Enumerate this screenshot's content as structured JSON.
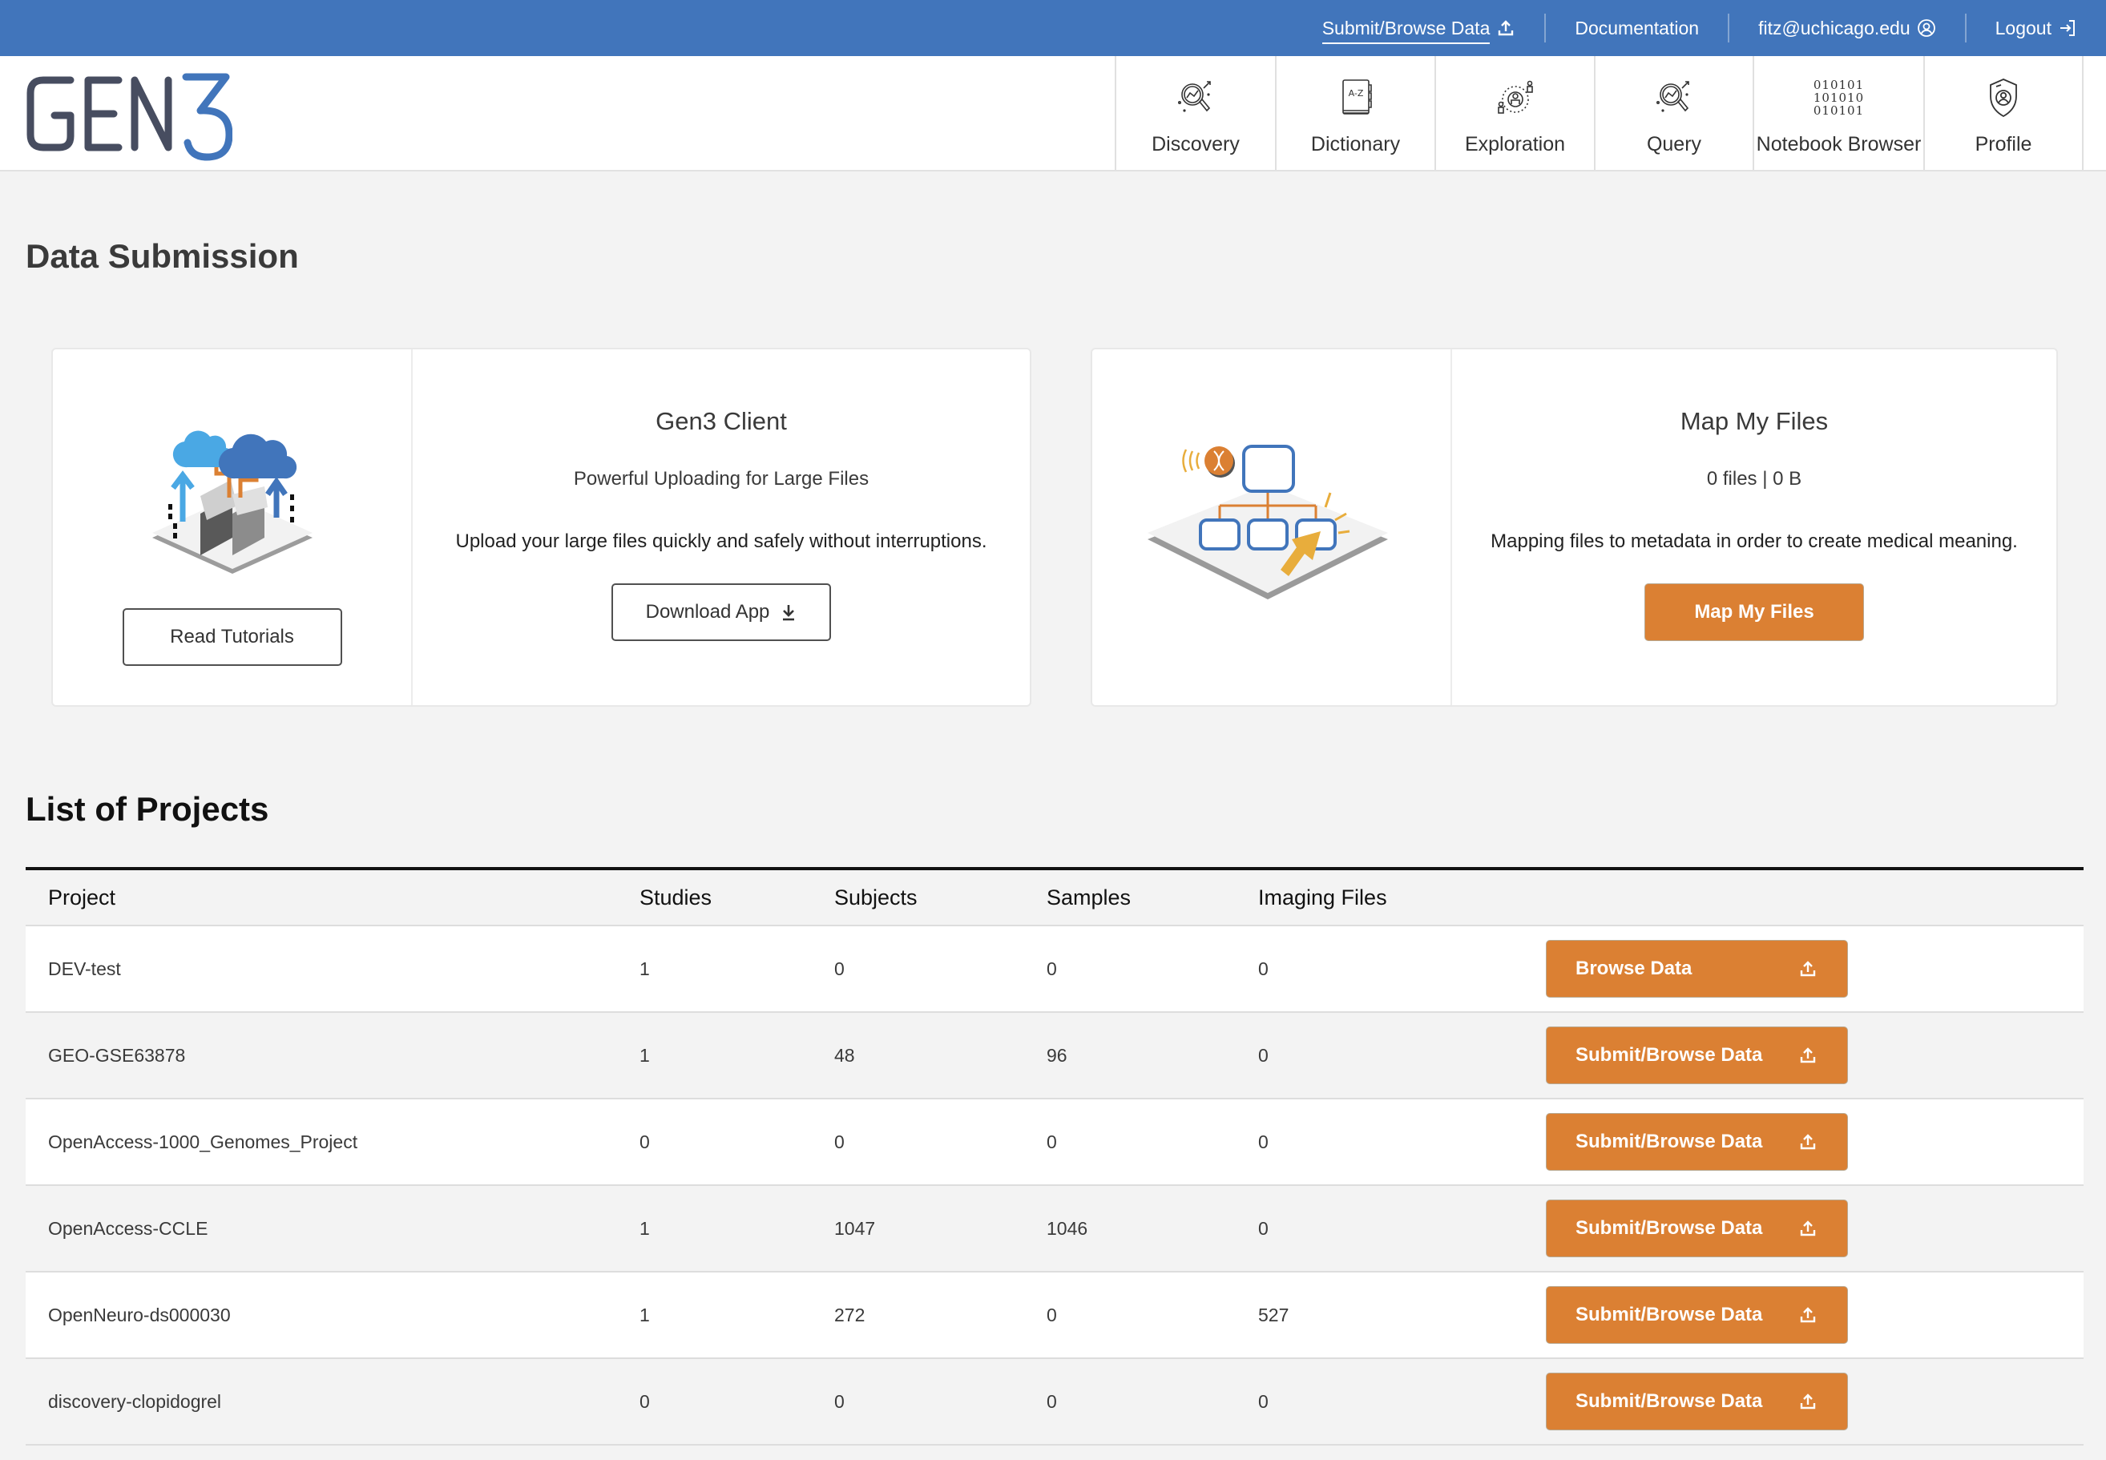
{
  "topbar": {
    "items": [
      {
        "label": "Submit/Browse Data",
        "icon": "upload-icon",
        "active": true
      },
      {
        "label": "Documentation",
        "icon": null
      },
      {
        "label": "fitz@uchicago.edu",
        "icon": "user-circle-icon"
      },
      {
        "label": "Logout",
        "icon": "logout-icon"
      }
    ]
  },
  "header": {
    "logo": {
      "text_dark": "GEN",
      "text_accent": "3"
    },
    "nav": [
      {
        "label": "Discovery",
        "icon": "discovery-magnifier-icon"
      },
      {
        "label": "Dictionary",
        "icon": "dictionary-book-icon",
        "icon_text": "A-Z"
      },
      {
        "label": "Exploration",
        "icon": "exploration-people-icon"
      },
      {
        "label": "Query",
        "icon": "query-magnifier-icon"
      },
      {
        "label": "Notebook Browser",
        "icon": "binary-icon",
        "icon_lines": [
          "010101",
          "101010",
          "010101"
        ]
      },
      {
        "label": "Profile",
        "icon": "profile-shield-icon"
      }
    ]
  },
  "submission": {
    "title": "Data Submission",
    "client_card": {
      "tutorial_button": "Read Tutorials",
      "title": "Gen3 Client",
      "subtitle": "Powerful Uploading for Large Files",
      "description": "Upload your large files quickly and safely without interruptions.",
      "download_button": "Download App"
    },
    "map_card": {
      "title": "Map My Files",
      "stats": "0 files | 0 B",
      "description": "Mapping files to metadata in order to create medical meaning.",
      "button": "Map My Files"
    }
  },
  "projects": {
    "title": "List of Projects",
    "columns": [
      "Project",
      "Studies",
      "Subjects",
      "Samples",
      "Imaging Files"
    ],
    "rows": [
      {
        "project": "DEV-test",
        "studies": "1",
        "subjects": "0",
        "samples": "0",
        "imaging_files": "0",
        "action": "Browse Data"
      },
      {
        "project": "GEO-GSE63878",
        "studies": "1",
        "subjects": "48",
        "samples": "96",
        "imaging_files": "0",
        "action": "Submit/Browse Data"
      },
      {
        "project": "OpenAccess-1000_Genomes_Project",
        "studies": "0",
        "subjects": "0",
        "samples": "0",
        "imaging_files": "0",
        "action": "Submit/Browse Data"
      },
      {
        "project": "OpenAccess-CCLE",
        "studies": "1",
        "subjects": "1047",
        "samples": "1046",
        "imaging_files": "0",
        "action": "Submit/Browse Data"
      },
      {
        "project": "OpenNeuro-ds000030",
        "studies": "1",
        "subjects": "272",
        "samples": "0",
        "imaging_files": "527",
        "action": "Submit/Browse Data"
      },
      {
        "project": "discovery-clopidogrel",
        "studies": "0",
        "subjects": "0",
        "samples": "0",
        "imaging_files": "0",
        "action": "Submit/Browse Data"
      }
    ]
  },
  "colors": {
    "topbar": "#4175bb",
    "accent_orange": "#db8033",
    "logo_dark": "#474d60",
    "logo_blue": "#4175bb",
    "page_bg": "#f3f3f3"
  }
}
